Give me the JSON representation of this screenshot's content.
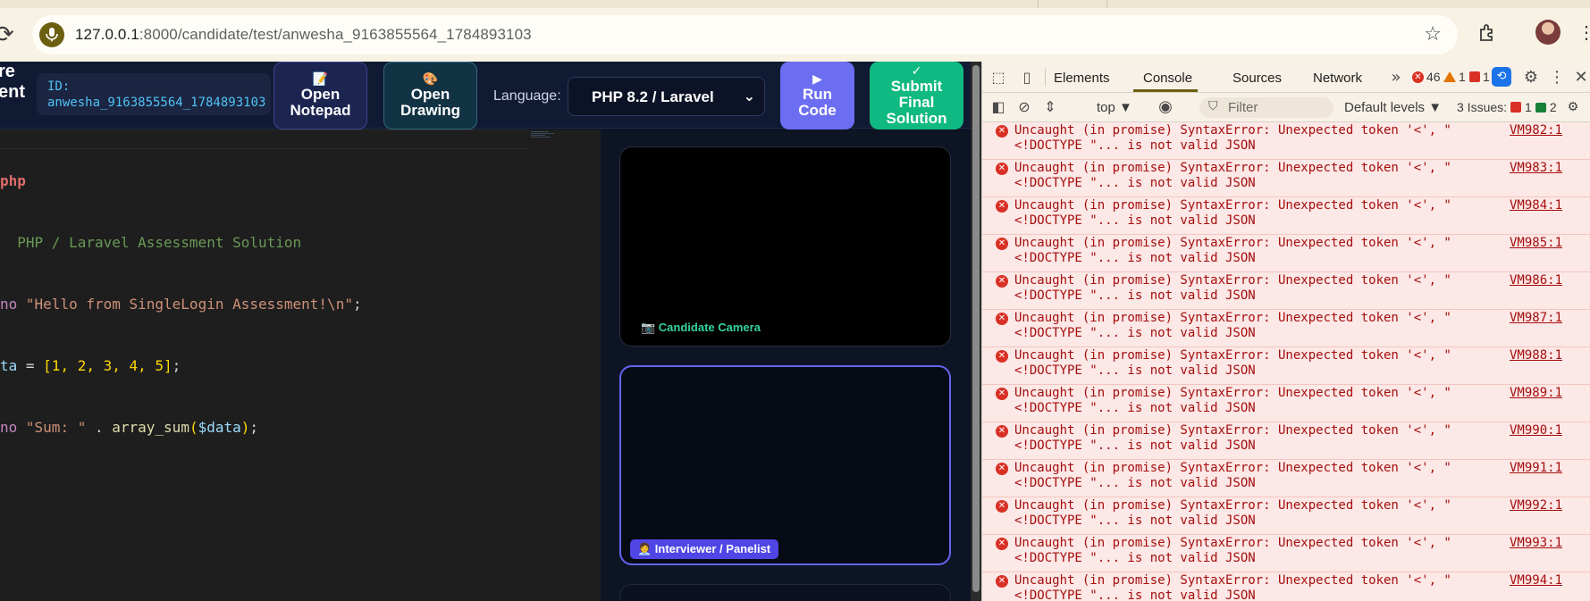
{
  "browser": {
    "url_host": "127.0.0.1",
    "url_path": ":8000/candidate/test/anwesha_9163855564_1784893103"
  },
  "app": {
    "brand_line1": "re",
    "brand_line2": "ent",
    "candidate_id_label": "ID:",
    "candidate_id_value": "anwesha_9163855564_1784893103",
    "notepad": {
      "icon": "📝",
      "line1": "Open",
      "line2": "Notepad"
    },
    "drawing": {
      "icon": "🎨",
      "line1": "Open",
      "line2": "Drawing"
    },
    "language_label": "Language:",
    "language_value": "PHP 8.2 / Laravel",
    "run": {
      "icon": "▶",
      "line1": "Run",
      "line2": "Code"
    },
    "submit": {
      "icon": "✓",
      "line1": "Submit",
      "line2": "Final",
      "line3": "Solution"
    }
  },
  "editor": {
    "lines": [
      {
        "tag": "php"
      },
      {
        "comment": "PHP / Laravel Assessment Solution"
      },
      {
        "kw": "no",
        "str": "\"Hello from SingleLogin Assessment!\\n\"",
        "end": ";"
      },
      {
        "var": "ta",
        "mid": " = ",
        "arr": "[1, 2, 3, 4, 5]",
        "end": ";"
      },
      {
        "kw": "no",
        "str": "\"Sum: \"",
        "mid": " . ",
        "fn": "array_sum",
        "arg": "$data",
        "end": ";"
      }
    ]
  },
  "video": {
    "camera_label": "📷 Candidate Camera",
    "interviewer_label": "🧑‍💼 Interviewer / Panelist"
  },
  "devtools": {
    "tabs": [
      "Elements",
      "Console",
      "Sources",
      "Network"
    ],
    "active_tab": "Console",
    "error_count": "46",
    "warning_count": "1",
    "issue_flag_count": "1",
    "context": "top ▼",
    "filter_placeholder": "Filter",
    "levels": "Default levels ▼",
    "issues_label": "3 Issues:",
    "issues_error": "1",
    "issues_info": "2",
    "log_line1": "Uncaught (in promise) SyntaxError: Unexpected token '<', \"",
    "log_line2": "<!DOCTYPE \"... is not valid JSON",
    "logs": [
      "VM982:1",
      "VM983:1",
      "VM984:1",
      "VM985:1",
      "VM986:1",
      "VM987:1",
      "VM988:1",
      "VM989:1",
      "VM990:1",
      "VM991:1",
      "VM992:1",
      "VM993:1",
      "VM994:1"
    ]
  }
}
